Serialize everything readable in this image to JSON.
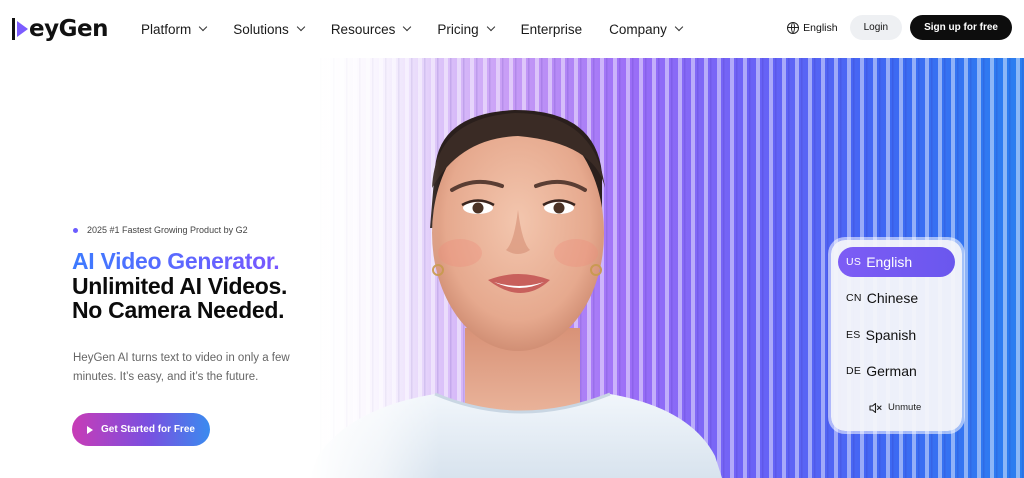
{
  "nav": {
    "logo_text": "eyGen",
    "menu": [
      {
        "label": "Platform",
        "dropdown": true
      },
      {
        "label": "Solutions",
        "dropdown": true
      },
      {
        "label": "Resources",
        "dropdown": true
      },
      {
        "label": "Pricing",
        "dropdown": true
      },
      {
        "label": "Enterprise",
        "dropdown": false
      },
      {
        "label": "Company",
        "dropdown": true
      }
    ],
    "language": "English",
    "login_label": "Login",
    "signup_label": "Sign up for free"
  },
  "hero": {
    "badge": "2025 #1 Fastest Growing Product by G2",
    "title_highlight": "AI Video Generator.",
    "title_line2": "Unlimited AI Videos.",
    "title_line3": "No Camera Needed.",
    "description": "HeyGen AI turns text to video in only a few minutes. It’s easy, and it’s the future.",
    "cta_label": "Get Started for Free"
  },
  "language_panel": {
    "options": [
      {
        "code": "US",
        "label": "English",
        "active": true
      },
      {
        "code": "CN",
        "label": "Chinese",
        "active": false
      },
      {
        "code": "ES",
        "label": "Spanish",
        "active": false
      },
      {
        "code": "DE",
        "label": "German",
        "active": false
      }
    ],
    "unmute_label": "Unmute"
  },
  "colors": {
    "accent_purple": "#7a55ff",
    "accent_blue": "#3d7bff",
    "signup_bg": "#0d0d0d",
    "cta_gradient": [
      "#c83cb6",
      "#7a4fe0",
      "#3a8bef"
    ]
  },
  "icons": [
    "play-logo-icon",
    "chevron-down-icon",
    "globe-icon",
    "play-icon",
    "speaker-muted-icon"
  ]
}
